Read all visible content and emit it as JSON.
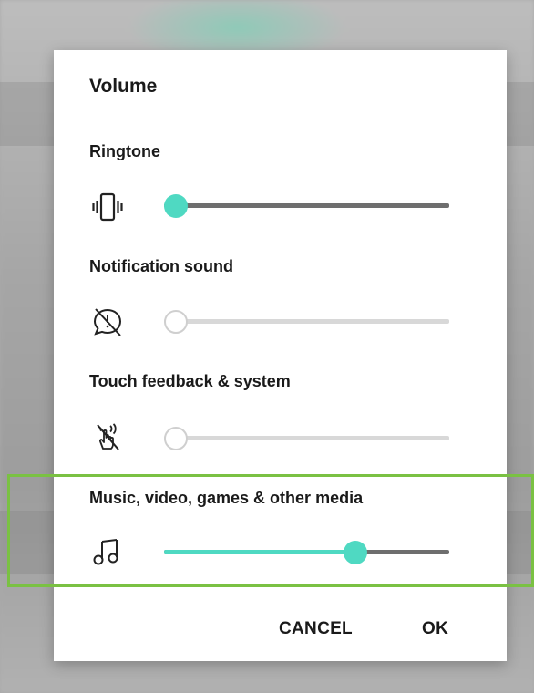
{
  "dialog": {
    "title": "Volume",
    "sections": [
      {
        "label": "Ringtone",
        "icon": "vibrate-icon",
        "level": 0.0,
        "enabled": true
      },
      {
        "label": "Notification sound",
        "icon": "notification-muted-icon",
        "level": 0.0,
        "enabled": false
      },
      {
        "label": "Touch feedback & system",
        "icon": "touch-feedback-muted-icon",
        "level": 0.0,
        "enabled": false
      },
      {
        "label": "Music, video, games & other media",
        "icon": "music-note-icon",
        "level": 0.67,
        "enabled": true
      }
    ],
    "buttons": {
      "cancel": "CANCEL",
      "ok": "OK"
    }
  },
  "colors": {
    "accent": "#4fd9c2",
    "track_active": "#6e6e6e",
    "track_disabled": "#d8d8d8",
    "highlight": "#7ac143"
  }
}
